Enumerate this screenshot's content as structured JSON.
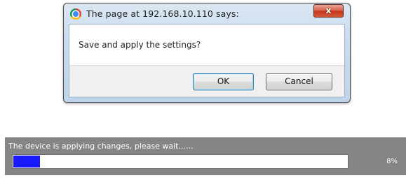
{
  "dialog": {
    "title": "The page at 192.168.10.110 says:",
    "close_label": "x",
    "message": "Save and apply the settings?",
    "ok_label": "OK",
    "cancel_label": "Cancel",
    "icon": "chrome-icon"
  },
  "progress": {
    "label": "The device is applying changes, please wait......",
    "percent_text": "8%",
    "value": 0.08,
    "fill_color": "#1a1aff",
    "panel_color": "#858585"
  }
}
